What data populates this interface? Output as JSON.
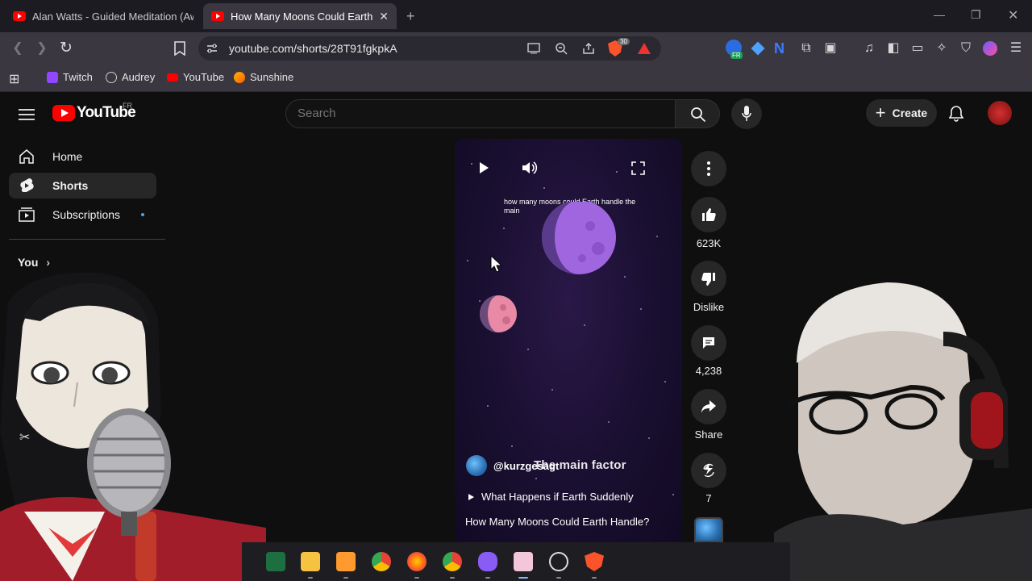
{
  "browser": {
    "tabs": [
      {
        "title": "Alan Watts - Guided Meditation (Awa",
        "active": false
      },
      {
        "title": "How Many Moons Could Earth H",
        "active": true
      }
    ],
    "url": "youtube.com/shorts/28T91fgkpkA",
    "shield_count": "30",
    "lang_badge": "FR",
    "bookmarks": [
      "Twitch",
      "Audrey",
      "YouTube",
      "Sunshine"
    ]
  },
  "youtube": {
    "logo_text": "YouTube",
    "region": "FR",
    "search_placeholder": "Search",
    "create_label": "Create",
    "sidebar": {
      "items": [
        {
          "label": "Home"
        },
        {
          "label": "Shorts"
        },
        {
          "label": "Subscriptions"
        }
      ],
      "you_label": "You"
    }
  },
  "short": {
    "overlay_caption": "how many moons could Earth handle the main",
    "channel_handle": "@kurzgesagt",
    "subtitle_overlay": "The main factor",
    "description": "What Happens if Earth Suddenly",
    "title": "How Many Moons Could Earth Handle?"
  },
  "actions": {
    "likes": "623K",
    "dislike_label": "Dislike",
    "comments": "4,238",
    "share_label": "Share",
    "remix_count": "7"
  },
  "colors": {
    "yt_red": "#ff0000",
    "bg": "#0f0f0f",
    "browser_chrome": "#3a3740"
  }
}
